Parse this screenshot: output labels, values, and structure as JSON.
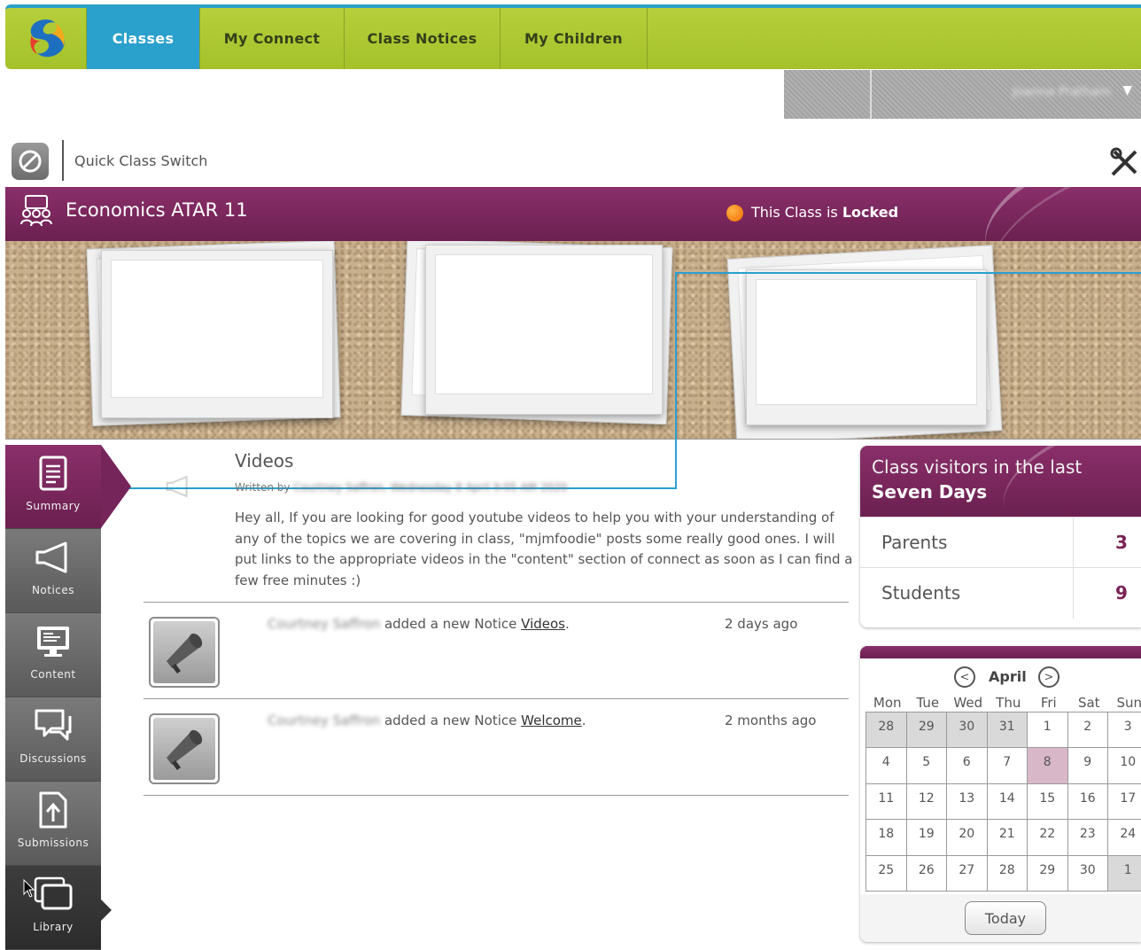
{
  "nav": {
    "tabs": [
      {
        "label": "Classes",
        "active": true
      },
      {
        "label": "My Connect",
        "active": false
      },
      {
        "label": "Class Notices",
        "active": false
      },
      {
        "label": "My Children",
        "active": false
      }
    ]
  },
  "user": {
    "name": "Joanna Pratham"
  },
  "quick_switch": {
    "label": "Quick Class Switch"
  },
  "class_header": {
    "title": "Economics ATAR 11",
    "lock_prefix": "This Class is ",
    "lock_state": "Locked",
    "lock_color": "#ef6a00"
  },
  "sidenav": {
    "items": [
      {
        "label": "Summary",
        "icon": "document-icon",
        "state": "active"
      },
      {
        "label": "Notices",
        "icon": "megaphone-icon",
        "state": "normal"
      },
      {
        "label": "Content",
        "icon": "monitor-icon",
        "state": "normal"
      },
      {
        "label": "Discussions",
        "icon": "speech-bubble-icon",
        "state": "normal"
      },
      {
        "label": "Submissions",
        "icon": "upload-icon",
        "state": "normal"
      },
      {
        "label": "Library",
        "icon": "stacked-folders-icon",
        "state": "dark"
      }
    ]
  },
  "notice": {
    "title": "Videos",
    "written_by_label": "Written by",
    "author_blurred": "Courtney Saffron, Wednesday 8 April 9:05 AM 2020",
    "body": "Hey all, If you are looking for good youtube videos to help you with your understanding of any of the topics we are covering in class, \"mjmfoodie\" posts some really good ones. I will put links to the appropriate videos in the \"content\" section of connect as soon as I can find a few free minutes :)"
  },
  "activity": [
    {
      "author": "Courtney Saffron",
      "action": "added a new Notice",
      "link": "Videos",
      "trailing": ".",
      "time": "2 days ago"
    },
    {
      "author": "Courtney Saffron",
      "action": "added a new Notice",
      "link": "Welcome",
      "trailing": ".",
      "time": "2 months ago"
    }
  ],
  "visitors": {
    "heading_line1": "Class visitors in the last",
    "heading_line2": "Seven Days",
    "rows": [
      {
        "label": "Parents",
        "count": "3"
      },
      {
        "label": "Students",
        "count": "9"
      }
    ]
  },
  "calendar": {
    "month": "April",
    "dow": [
      "Mon",
      "Tue",
      "Wed",
      "Thu",
      "Fri",
      "Sat",
      "Sun"
    ],
    "weeks": [
      [
        {
          "d": "28",
          "t": "other"
        },
        {
          "d": "29",
          "t": "other"
        },
        {
          "d": "30",
          "t": "other"
        },
        {
          "d": "31",
          "t": "other"
        },
        {
          "d": "1",
          "t": ""
        },
        {
          "d": "2",
          "t": ""
        },
        {
          "d": "3",
          "t": ""
        }
      ],
      [
        {
          "d": "4",
          "t": ""
        },
        {
          "d": "5",
          "t": ""
        },
        {
          "d": "6",
          "t": ""
        },
        {
          "d": "7",
          "t": ""
        },
        {
          "d": "8",
          "t": "today"
        },
        {
          "d": "9",
          "t": ""
        },
        {
          "d": "10",
          "t": ""
        }
      ],
      [
        {
          "d": "11",
          "t": ""
        },
        {
          "d": "12",
          "t": ""
        },
        {
          "d": "13",
          "t": ""
        },
        {
          "d": "14",
          "t": ""
        },
        {
          "d": "15",
          "t": ""
        },
        {
          "d": "16",
          "t": ""
        },
        {
          "d": "17",
          "t": ""
        }
      ],
      [
        {
          "d": "18",
          "t": ""
        },
        {
          "d": "19",
          "t": ""
        },
        {
          "d": "20",
          "t": ""
        },
        {
          "d": "21",
          "t": ""
        },
        {
          "d": "22",
          "t": ""
        },
        {
          "d": "23",
          "t": ""
        },
        {
          "d": "24",
          "t": ""
        }
      ],
      [
        {
          "d": "25",
          "t": ""
        },
        {
          "d": "26",
          "t": ""
        },
        {
          "d": "27",
          "t": ""
        },
        {
          "d": "28",
          "t": ""
        },
        {
          "d": "29",
          "t": ""
        },
        {
          "d": "30",
          "t": ""
        },
        {
          "d": "1",
          "t": "other"
        }
      ]
    ],
    "today_label": "Today"
  }
}
